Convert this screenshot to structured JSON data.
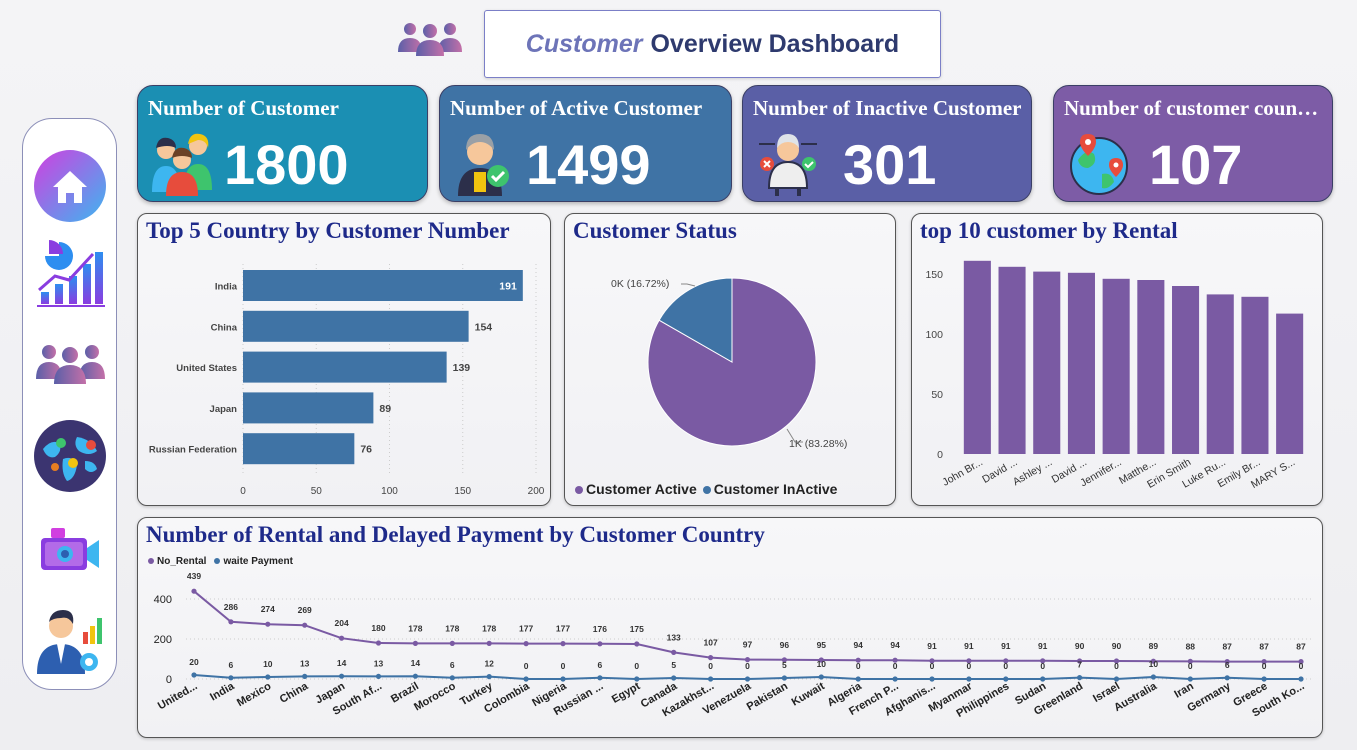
{
  "header": {
    "title_accent": "Customer",
    "title_rest": "Overview Dashboard",
    "icon": "people-group-icon"
  },
  "sidebar": {
    "items": [
      {
        "name": "home-icon"
      },
      {
        "name": "analytics-chart-icon"
      },
      {
        "name": "people-group-icon"
      },
      {
        "name": "world-map-icon"
      },
      {
        "name": "video-camera-icon"
      },
      {
        "name": "manager-settings-icon"
      }
    ]
  },
  "kpis": [
    {
      "title": "Number of Customer",
      "value": "1800",
      "color": "#1b8fb3",
      "icon": "customers-icon"
    },
    {
      "title": "Number of Active Customer",
      "value": "1499",
      "color": "#3f73a5",
      "icon": "active-customer-icon"
    },
    {
      "title": "Number of Inactive Customer",
      "value": "301",
      "color": "#5a5fa6",
      "icon": "inactive-customer-icon"
    },
    {
      "title": "Number of customer coun…",
      "value": "107",
      "color": "#7d5ca6",
      "icon": "globe-pin-icon"
    }
  ],
  "colors": {
    "bar_blue": "#3f73a5",
    "purple": "#7a5aa3",
    "line_blue": "#3f73a5"
  },
  "chart_data": [
    {
      "type": "bar",
      "orientation": "horizontal",
      "title": "Top 5 Country by Customer Number",
      "categories": [
        "India",
        "China",
        "United States",
        "Japan",
        "Russian Federation"
      ],
      "values": [
        191,
        154,
        139,
        89,
        76
      ],
      "xlim": [
        0,
        200
      ],
      "xticks": [
        0,
        50,
        100,
        150,
        200
      ]
    },
    {
      "type": "pie",
      "title": "Customer Status",
      "labels": [
        "Customer Active",
        "Customer InActive"
      ],
      "values": [
        83.28,
        16.72
      ],
      "slice_labels": [
        "1K (83.28%)",
        "0K (16.72%)"
      ],
      "legend": "bottom"
    },
    {
      "type": "bar",
      "title": "top 10 customer by Rental",
      "categories": [
        "John Br...",
        "David ...",
        "Ashley ...",
        "David ...",
        "Jennifer...",
        "Matthe...",
        "Erin Smith",
        "Luke Ru...",
        "Emily Br...",
        "MARY S..."
      ],
      "values": [
        161,
        156,
        152,
        151,
        146,
        145,
        140,
        133,
        131,
        117
      ],
      "ylim": [
        0,
        160
      ],
      "yticks": [
        0,
        50,
        100,
        150
      ]
    },
    {
      "type": "line",
      "title": "Number of Rental and Delayed Payment by Customer Country",
      "legend": "top-left",
      "categories": [
        "United...",
        "India",
        "Mexico",
        "China",
        "Japan",
        "South Af...",
        "Brazil",
        "Morocco",
        "Turkey",
        "Colombia",
        "Nigeria",
        "Russian ...",
        "Egypt",
        "Canada",
        "Kazakhst...",
        "Venezuela",
        "Pakistan",
        "Kuwait",
        "Algeria",
        "French P...",
        "Afghanis...",
        "Myanmar",
        "Philippines",
        "Sudan",
        "Greenland",
        "Israel",
        "Australia",
        "Iran",
        "Germany",
        "Greece",
        "South Ko..."
      ],
      "ylim": [
        0,
        450
      ],
      "yticks": [
        0,
        200,
        400
      ],
      "series": [
        {
          "name": "No_Rental",
          "values": [
            439,
            286,
            274,
            269,
            204,
            180,
            178,
            178,
            178,
            177,
            177,
            176,
            175,
            133,
            107,
            97,
            96,
            95,
            94,
            94,
            91,
            91,
            91,
            91,
            90,
            90,
            89,
            88,
            87,
            87,
            87
          ],
          "labels": [
            "439",
            "286",
            "274",
            "269",
            "204",
            "180",
            "178",
            "178",
            "178",
            "177",
            "177",
            "176",
            "175",
            "133",
            "107",
            "97",
            "96",
            "95",
            "94",
            "94",
            "91",
            "91",
            "91",
            "91",
            "90",
            "90",
            "89",
            "88",
            "87",
            "87",
            "87"
          ]
        },
        {
          "name": "waite Payment",
          "values": [
            20,
            6,
            10,
            13,
            14,
            13,
            14,
            6,
            12,
            0,
            0,
            6,
            0,
            5,
            0,
            0,
            5,
            10,
            0,
            0,
            0,
            0,
            0,
            0,
            7,
            0,
            10,
            0,
            6,
            0,
            0
          ],
          "labels": [
            "20",
            "6",
            "10",
            "13",
            "14",
            "13",
            "14",
            "6",
            "12",
            "0",
            "0",
            "6",
            "0",
            "5",
            "0",
            "0",
            "5",
            "10",
            "0",
            "0",
            "0",
            "0",
            "0",
            "0",
            "7",
            "0",
            "10",
            "0",
            "6",
            "0",
            "0"
          ]
        }
      ]
    }
  ]
}
